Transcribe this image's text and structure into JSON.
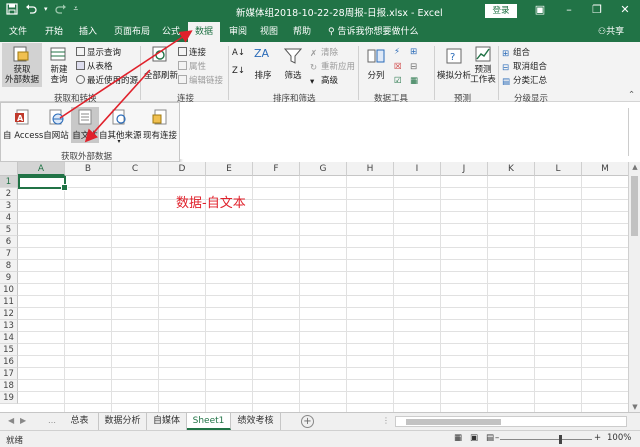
{
  "window": {
    "title": "新媒体组2018-10-22-28周报-日报.xlsx  -  Excel",
    "login_label": "登录"
  },
  "tabs": [
    {
      "label": "文件"
    },
    {
      "label": "开始"
    },
    {
      "label": "插入"
    },
    {
      "label": "页面布局"
    },
    {
      "label": "公式"
    },
    {
      "label": "数据"
    },
    {
      "label": "审阅"
    },
    {
      "label": "视图"
    },
    {
      "label": "帮助"
    }
  ],
  "tell_me": "告诉我你想要做什么",
  "share": "共享",
  "ribbon": {
    "get_external": "获取\n外部数据",
    "new_query": "新建\n查询",
    "show_queries": "显示查询",
    "from_table": "从表格",
    "recent_sources": "最近使用的源",
    "group_get_transform": "获取和转换",
    "refresh_all": "全部刷新",
    "connections": "连接",
    "properties": "属性",
    "edit_links": "编辑链接",
    "group_connections": "连接",
    "sort": "排序",
    "filter": "筛选",
    "clear": "清除",
    "reapply": "重新应用",
    "advanced": "高级",
    "group_sort_filter": "排序和筛选",
    "text_to_columns": "分列",
    "group_data_tools": "数据工具",
    "what_if": "模拟分析",
    "forecast_sheet": "预测\n工作表",
    "group_forecast": "预测",
    "group": "组合",
    "ungroup": "取消组合",
    "subtotal": "分类汇总",
    "group_outline": "分级显示"
  },
  "dropdown": {
    "items": [
      {
        "label": "自 Access"
      },
      {
        "label": "自网站"
      },
      {
        "label": "自文本"
      },
      {
        "label": "自其他来源"
      },
      {
        "label": "现有连接"
      }
    ],
    "group_label": "获取外部数据"
  },
  "grid": {
    "columns": [
      "A",
      "B",
      "C",
      "D",
      "E",
      "F",
      "G",
      "H",
      "I",
      "J",
      "K",
      "L",
      "M"
    ],
    "rows": [
      "1",
      "2",
      "3",
      "4",
      "5",
      "6",
      "7",
      "8",
      "9",
      "10",
      "11",
      "12",
      "13",
      "14",
      "15",
      "16",
      "17",
      "18",
      "19"
    ],
    "annotation": "数据-自文本"
  },
  "sheets": [
    {
      "label": "总表"
    },
    {
      "label": "数据分析"
    },
    {
      "label": "自媒体"
    },
    {
      "label": "Sheet1"
    },
    {
      "label": "绩效考核"
    }
  ],
  "status": {
    "ready": "就绪",
    "zoom": "100%"
  },
  "colors": {
    "brand_green": "#217346",
    "annotation_red": "#e0212b"
  }
}
